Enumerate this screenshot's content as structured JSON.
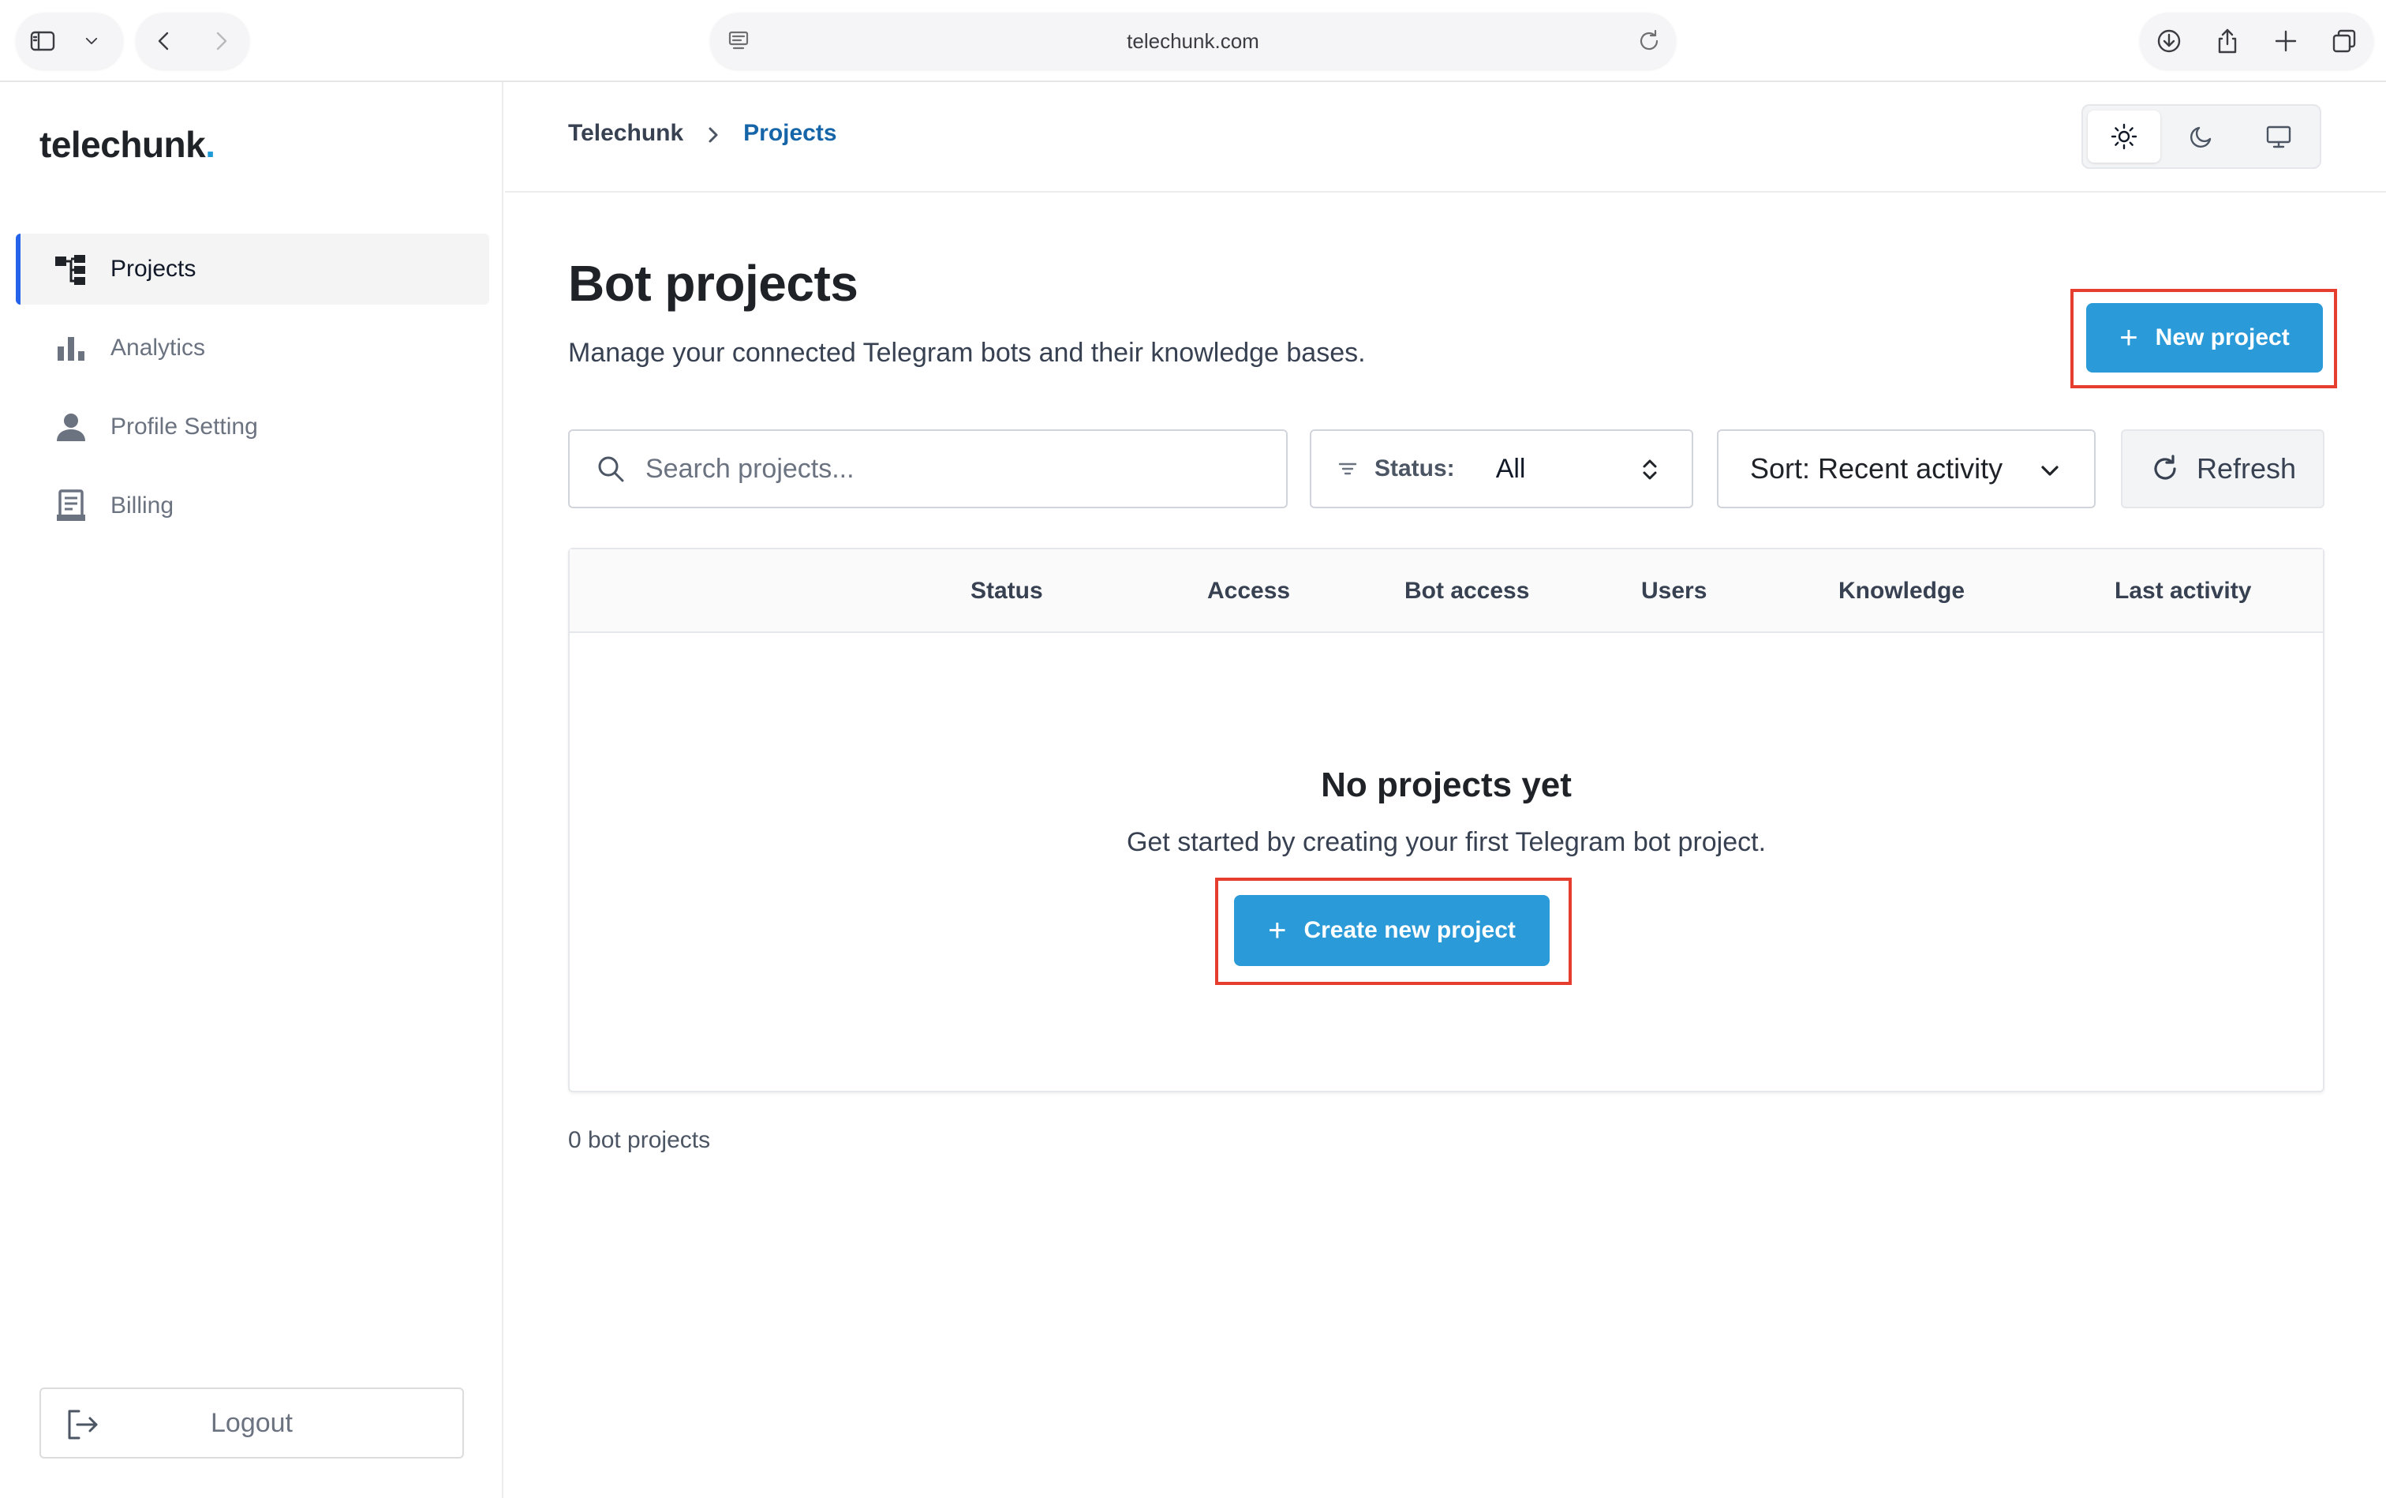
{
  "browser": {
    "url": "telechunk.com"
  },
  "sidebar": {
    "logo_text": "telechunk",
    "logo_dot": ".",
    "items": [
      {
        "label": "Projects",
        "icon": "projects-tree-icon",
        "active": true
      },
      {
        "label": "Analytics",
        "icon": "bar-chart-icon",
        "active": false
      },
      {
        "label": "Profile Setting",
        "icon": "user-icon",
        "active": false
      },
      {
        "label": "Billing",
        "icon": "receipt-icon",
        "active": false
      }
    ],
    "logout_label": "Logout"
  },
  "breadcrumb": {
    "root": "Telechunk",
    "current": "Projects"
  },
  "theme": {
    "options": [
      "light",
      "dark",
      "system"
    ],
    "selected": "light"
  },
  "page": {
    "title": "Bot projects",
    "subtitle": "Manage your connected Telegram bots and their knowledge bases.",
    "new_project_label": "New project"
  },
  "filters": {
    "search_placeholder": "Search projects...",
    "status_label": "Status:",
    "status_value": "All",
    "sort_label": "Sort: Recent activity",
    "refresh_label": "Refresh"
  },
  "table": {
    "columns": [
      "Status",
      "Access",
      "Bot access",
      "Users",
      "Knowledge",
      "Last activity"
    ],
    "empty_title": "No projects yet",
    "empty_subtitle": "Get started by creating your first Telegram bot project.",
    "create_label": "Create new project"
  },
  "footer": {
    "count_text": "0 bot projects"
  },
  "colors": {
    "accent": "#2b9ad9",
    "link": "#1565a8",
    "highlight": "#e53e2f"
  }
}
